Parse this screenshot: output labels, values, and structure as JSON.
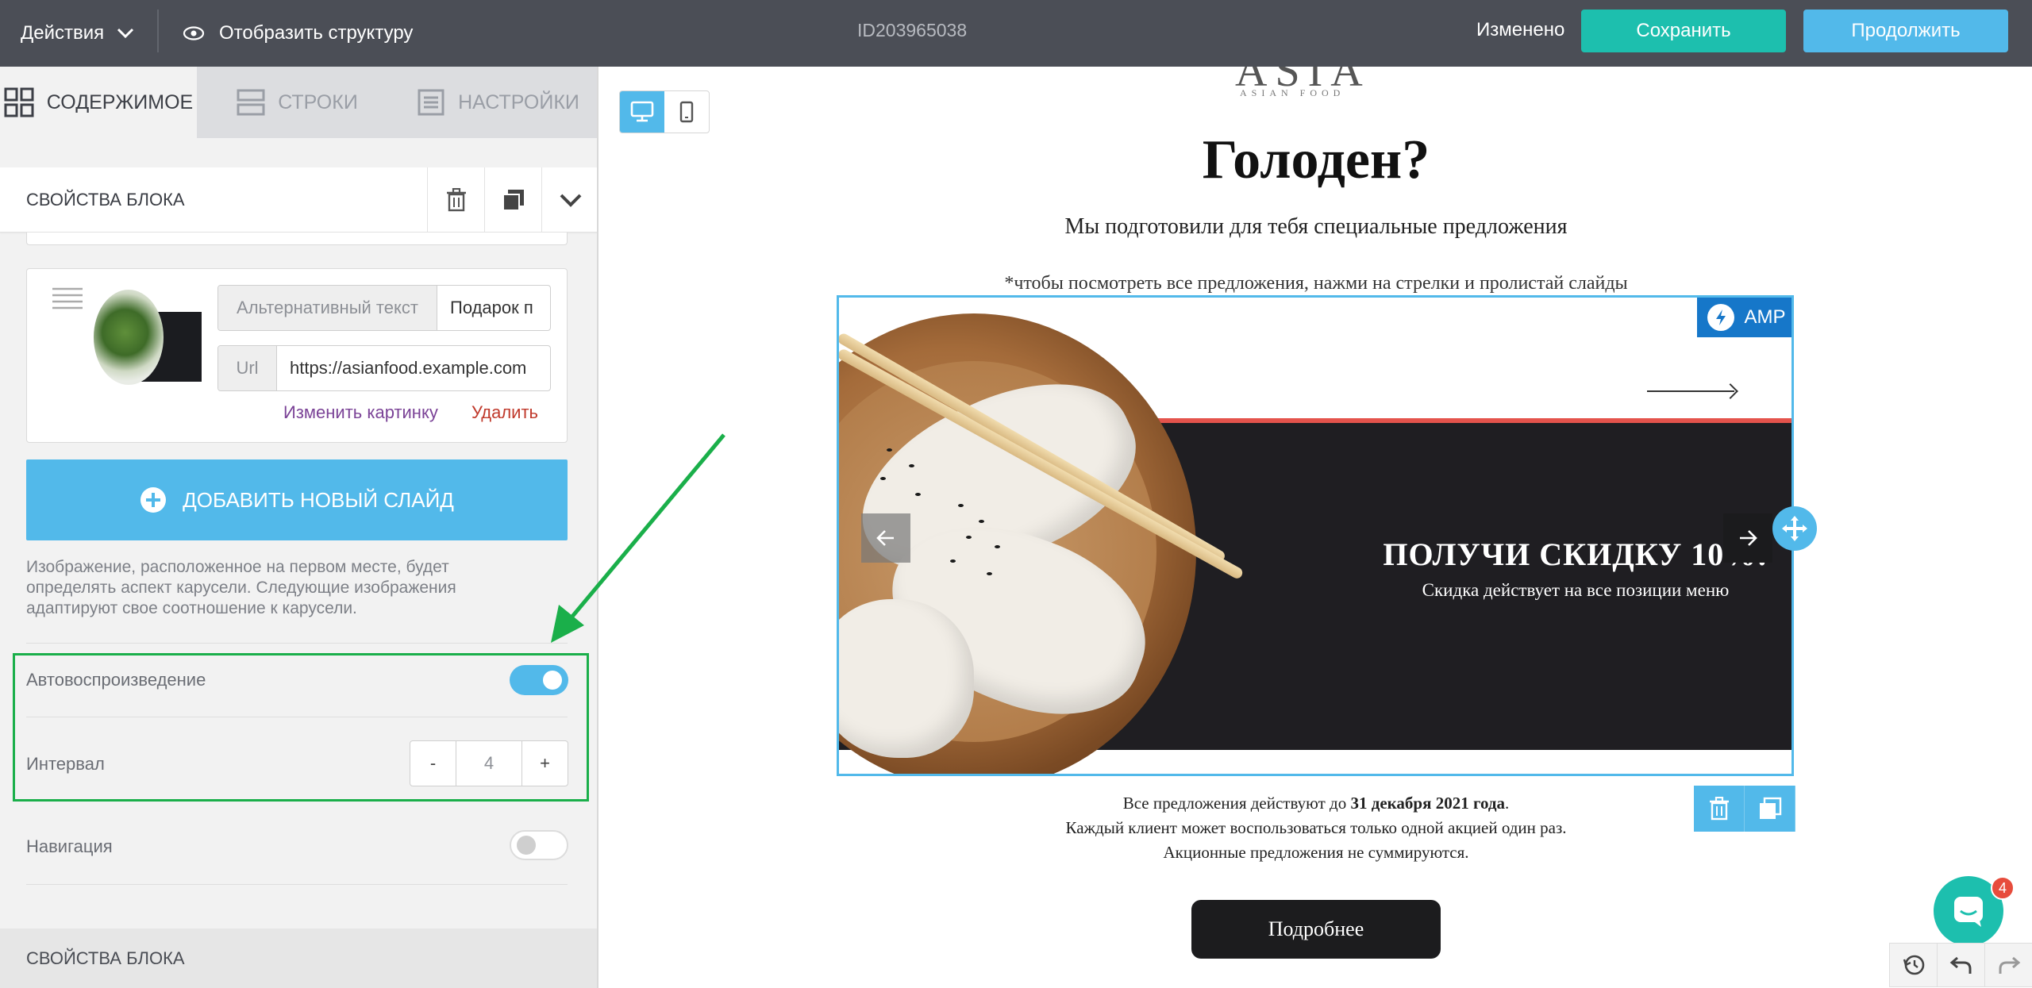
{
  "topbar": {
    "actions_label": "Действия",
    "structure_label": "Отобразить структуру",
    "document_id": "ID203965038",
    "status": "Изменено",
    "save_label": "Сохранить",
    "continue_label": "Продолжить"
  },
  "left_panel": {
    "tabs": [
      {
        "label": "СОДЕРЖИМОЕ",
        "icon": "grid-icon",
        "active": true
      },
      {
        "label": "СТРОКИ",
        "icon": "rows-icon",
        "active": false
      },
      {
        "label": "НАСТРОЙКИ",
        "icon": "settings-doc-icon",
        "active": false
      }
    ],
    "block_props_title": "СВОЙСТВА БЛОКА",
    "slide": {
      "alt_label": "Альтернативный текст",
      "alt_value": "Подарок п",
      "url_label": "Url",
      "url_value": "https://asianfood.example.com",
      "change_image": "Изменить картинку",
      "delete": "Удалить"
    },
    "add_slide_label": "ДОБАВИТЬ НОВЫЙ СЛАЙД",
    "hint": "Изображение, расположенное на первом месте, будет определять аспект карусели. Следующие изображения адаптируют свое соотношение к карусели.",
    "autoplay_label": "Автовоспроизведение",
    "autoplay_on": true,
    "interval_label": "Интервал",
    "interval_minus": "-",
    "interval_value": "4",
    "interval_plus": "+",
    "navigation_label": "Навигация",
    "navigation_on": false,
    "bottom_title": "СВОЙСТВА БЛОКА"
  },
  "canvas": {
    "logo": "ASIA",
    "logo_sub": "ASIAN FOOD",
    "title": "Голоден?",
    "subtitle": "Мы подготовили для тебя специальные предложения",
    "note": "*чтобы посмотреть все предложения, нажми на стрелки и пролистай слайды",
    "amp_badge": "AMP",
    "slide_heading": "ПОЛУЧИ СКИДКУ 10%!",
    "slide_text": "Скидка действует на все позиции меню",
    "footer_prefix": "Все предложения действуют до ",
    "footer_date": "31 декабря 2021 года",
    "footer_suffix": ".",
    "footer_line2": "Каждый клиент может воспользоваться только одной акцией один раз.",
    "footer_line3": "Акционные предложения не суммируются.",
    "more_button": "Подробнее",
    "chat_badge_count": "4"
  },
  "colors": {
    "topbar": "#4b4e56",
    "accent_blue": "#52b9ea",
    "save_green": "#1dbfae",
    "highlight_green": "#1aaf4a",
    "amp_blue": "#1677c9"
  }
}
